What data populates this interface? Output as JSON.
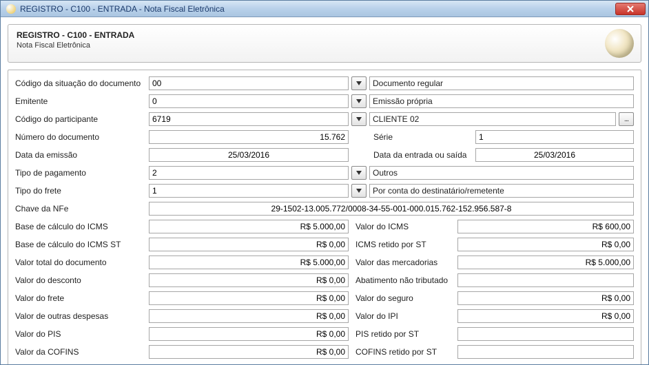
{
  "window": {
    "title": "REGISTRO - C100 - ENTRADA - Nota Fiscal Eletrônica"
  },
  "header": {
    "title": "REGISTRO - C100 - ENTRADA",
    "subtitle": "Nota Fiscal Eletrônica"
  },
  "labels": {
    "codigo_situacao": "Código da situação do documento",
    "emitente": "Emitente",
    "codigo_participante": "Código do participante",
    "numero_documento": "Número do documento",
    "serie": "Série",
    "data_emissao": "Data da emissão",
    "data_entrada": "Data da entrada ou saída",
    "tipo_pagamento": "Tipo de pagamento",
    "tipo_frete": "Tipo do frete",
    "chave_nfe": "Chave da NFe",
    "bc_icms": "Base de cálculo do ICMS",
    "valor_icms": "Valor do ICMS",
    "bc_icms_st": "Base de cálculo do ICMS ST",
    "icms_retido_st": "ICMS retido por ST",
    "valor_total_doc": "Valor total do documento",
    "valor_mercadorias": "Valor das mercadorias",
    "valor_desconto": "Valor do desconto",
    "abatimento_nt": "Abatimento não tributado",
    "valor_frete": "Valor do frete",
    "valor_seguro": "Valor do seguro",
    "valor_outras": "Valor de outras despesas",
    "valor_ipi": "Valor do IPI",
    "valor_pis": "Valor do PIS",
    "pis_retido_st": "PIS retido por ST",
    "valor_cofins": "Valor da COFINS",
    "cofins_retido_st": "COFINS retido por ST"
  },
  "values": {
    "codigo_situacao": "00",
    "codigo_situacao_desc": "Documento regular",
    "emitente": "0",
    "emitente_desc": "Emissão própria",
    "codigo_participante": "6719",
    "codigo_participante_desc": "CLIENTE 02",
    "numero_documento": "15.762",
    "serie": "1",
    "data_emissao": "25/03/2016",
    "data_entrada": "25/03/2016",
    "tipo_pagamento": "2",
    "tipo_pagamento_desc": "Outros",
    "tipo_frete": "1",
    "tipo_frete_desc": "Por conta do destinatário/remetente",
    "chave_nfe": "29-1502-13.005.772/0008-34-55-001-000.015.762-152.956.587-8",
    "bc_icms": "R$ 5.000,00",
    "valor_icms": "R$ 600,00",
    "bc_icms_st": "R$ 0,00",
    "icms_retido_st": "R$ 0,00",
    "valor_total_doc": "R$ 5.000,00",
    "valor_mercadorias": "R$ 5.000,00",
    "valor_desconto": "R$ 0,00",
    "abatimento_nt": "",
    "valor_frete": "R$ 0,00",
    "valor_seguro": "R$ 0,00",
    "valor_outras": "R$ 0,00",
    "valor_ipi": "R$ 0,00",
    "valor_pis": "R$ 0,00",
    "pis_retido_st": "",
    "valor_cofins": "R$ 0,00",
    "cofins_retido_st": ""
  },
  "lookup_btn": "..."
}
